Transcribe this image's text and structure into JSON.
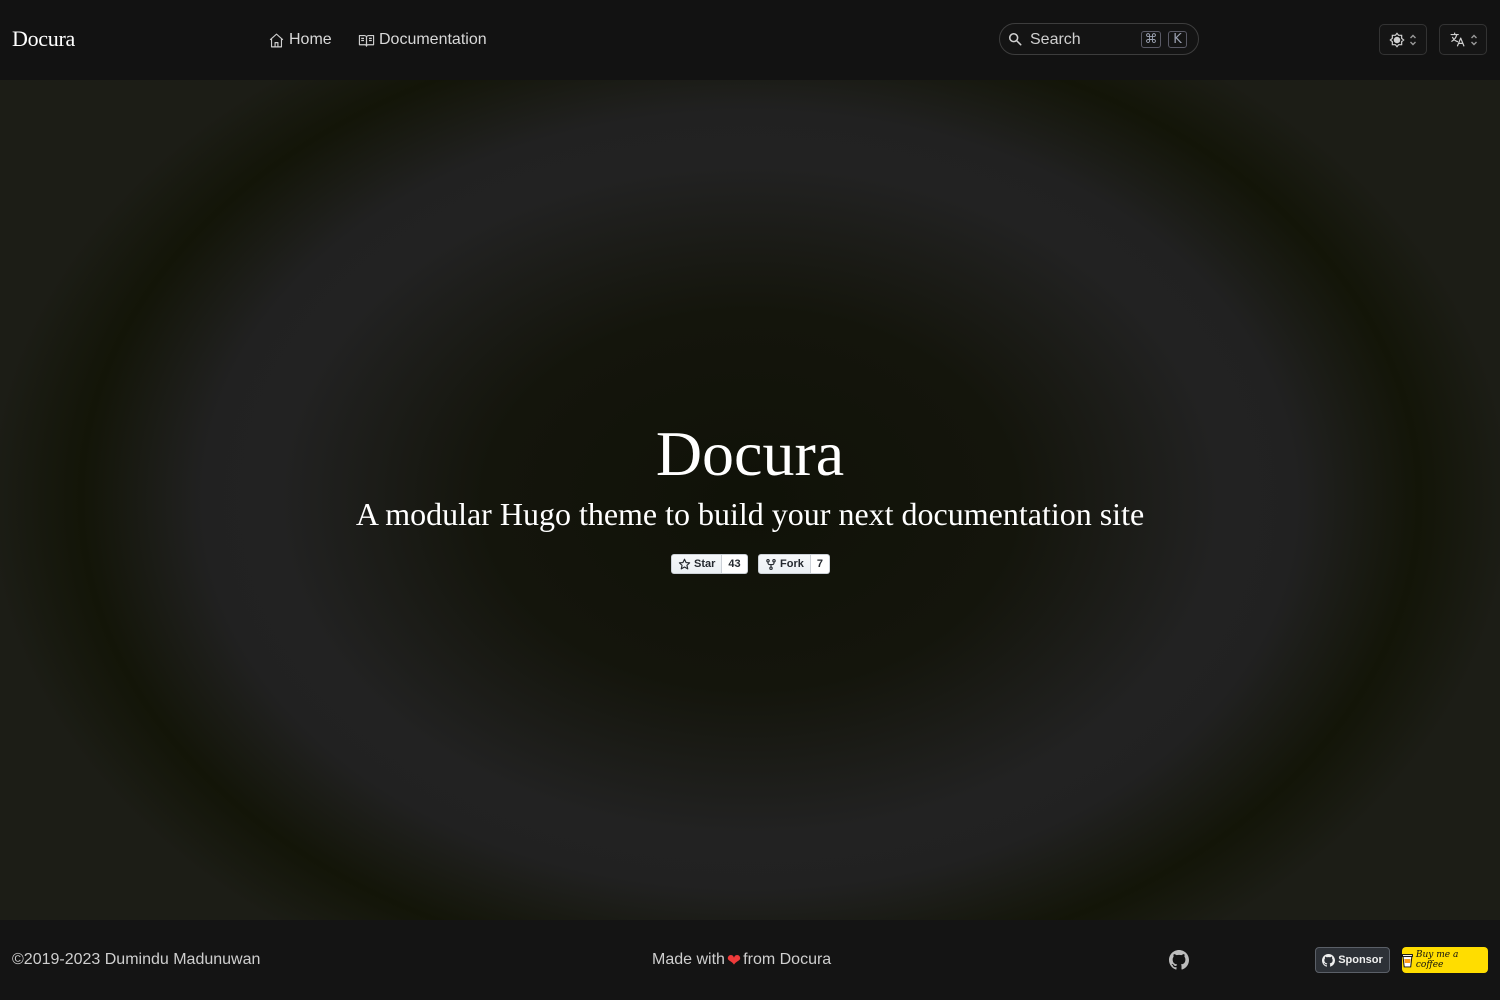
{
  "header": {
    "brand": "Docura",
    "nav": [
      {
        "label": "Home",
        "icon": "home-icon"
      },
      {
        "label": "Documentation",
        "icon": "book-icon"
      }
    ],
    "search": {
      "placeholder": "Search",
      "shortcut_cmd": "⌘",
      "shortcut_key": "K"
    },
    "theme_selector": {
      "icon": "brightness-icon"
    },
    "language_selector": {
      "icon": "translate-icon"
    }
  },
  "hero": {
    "title": "Docura",
    "subtitle": "A modular Hugo theme to build your next documentation site",
    "github_buttons": [
      {
        "label": "Star",
        "count": "43",
        "icon": "star-icon"
      },
      {
        "label": "Fork",
        "count": "7",
        "icon": "fork-icon"
      }
    ]
  },
  "footer": {
    "copyright": "©2019-2023 Dumindu Madunuwan",
    "made_with_prefix": "Made with",
    "heart": "❤",
    "made_with_suffix": "from Docura",
    "sponsor_label": "Sponsor",
    "coffee_label": "Buy me a coffee"
  },
  "colors": {
    "header_bg": "#121212",
    "footer_bg": "#141414",
    "heart": "#ef3b3b",
    "coffee_bg": "#ffdd00"
  }
}
